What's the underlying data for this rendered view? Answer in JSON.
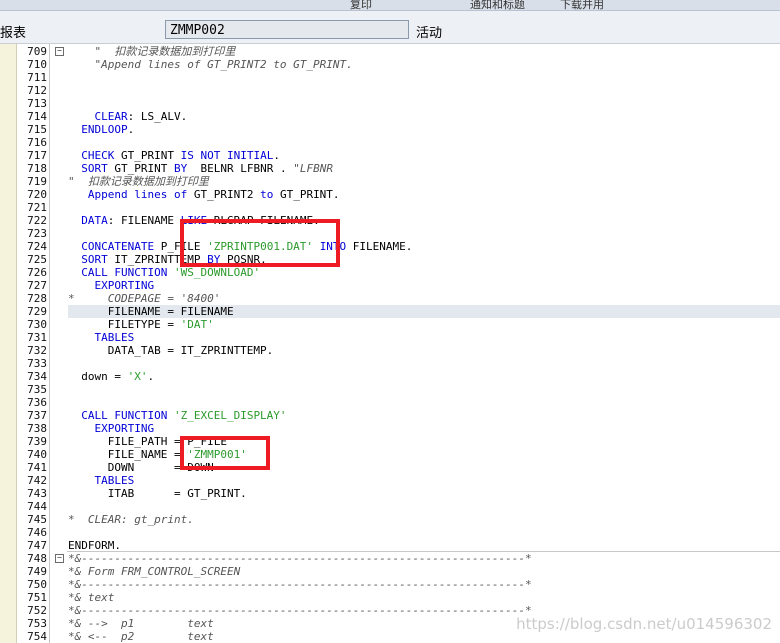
{
  "top_strip": {
    "text_fragments": [
      "复印",
      "通知和标题",
      "下载并用"
    ]
  },
  "header": {
    "label": "报表",
    "program": "ZMMP002",
    "status": "活动"
  },
  "watermark": "https://blog.csdn.net/u014596302",
  "lines": [
    {
      "n": "709",
      "fold": "minus",
      "segs": [
        [
          "c",
          "    \"  扣款记录数据加到打印里"
        ]
      ]
    },
    {
      "n": "710",
      "segs": [
        [
          "c",
          "    \"Append lines of GT_PRINT2 to GT_PRINT."
        ]
      ]
    },
    {
      "n": "711",
      "segs": []
    },
    {
      "n": "712",
      "segs": []
    },
    {
      "n": "713",
      "segs": []
    },
    {
      "n": "714",
      "segs": [
        [
          "t",
          "    "
        ],
        [
          "k",
          "CLEAR"
        ],
        [
          "t",
          ": LS_ALV."
        ]
      ]
    },
    {
      "n": "715",
      "segs": [
        [
          "t",
          "  "
        ],
        [
          "k",
          "ENDLOOP"
        ],
        [
          "t",
          "."
        ]
      ]
    },
    {
      "n": "716",
      "segs": []
    },
    {
      "n": "717",
      "segs": [
        [
          "t",
          "  "
        ],
        [
          "k",
          "CHECK"
        ],
        [
          "t",
          " GT_PRINT "
        ],
        [
          "k",
          "IS NOT INITIAL"
        ],
        [
          "t",
          "."
        ]
      ]
    },
    {
      "n": "718",
      "segs": [
        [
          "t",
          "  "
        ],
        [
          "k",
          "SORT"
        ],
        [
          "t",
          " GT_PRINT "
        ],
        [
          "k",
          "BY"
        ],
        [
          "t",
          "  BELNR LFBNR . "
        ],
        [
          "c",
          "\"LFBNR"
        ]
      ]
    },
    {
      "n": "719",
      "segs": [
        [
          "c",
          "\"  扣款记录数据加到打印里"
        ]
      ]
    },
    {
      "n": "720",
      "segs": [
        [
          "t",
          "   "
        ],
        [
          "k",
          "Append lines of"
        ],
        [
          "t",
          " GT_PRINT2 "
        ],
        [
          "k",
          "to"
        ],
        [
          "t",
          " GT_PRINT."
        ]
      ]
    },
    {
      "n": "721",
      "segs": []
    },
    {
      "n": "722",
      "segs": [
        [
          "t",
          "  "
        ],
        [
          "k",
          "DATA"
        ],
        [
          "t",
          ": FILENAME "
        ],
        [
          "k",
          "LIKE"
        ],
        [
          "t",
          " RLGRAP-FILENAME."
        ]
      ]
    },
    {
      "n": "723",
      "segs": []
    },
    {
      "n": "724",
      "segs": [
        [
          "t",
          "  "
        ],
        [
          "k",
          "CONCATENATE"
        ],
        [
          "t",
          " P_FILE "
        ],
        [
          "s",
          "'ZPRINTP001.DAT'"
        ],
        [
          "t",
          " "
        ],
        [
          "k",
          "INTO"
        ],
        [
          "t",
          " FILENAME."
        ]
      ]
    },
    {
      "n": "725",
      "segs": [
        [
          "t",
          "  "
        ],
        [
          "k",
          "SORT"
        ],
        [
          "t",
          " IT_ZPRINTTEMP "
        ],
        [
          "k",
          "BY"
        ],
        [
          "t",
          " POSNR."
        ]
      ]
    },
    {
      "n": "726",
      "segs": [
        [
          "t",
          "  "
        ],
        [
          "k",
          "CALL FUNCTION"
        ],
        [
          "t",
          " "
        ],
        [
          "s",
          "'WS_DOWNLOAD'"
        ]
      ]
    },
    {
      "n": "727",
      "segs": [
        [
          "t",
          "    "
        ],
        [
          "k",
          "EXPORTING"
        ]
      ]
    },
    {
      "n": "728",
      "segs": [
        [
          "c",
          "*     CODEPAGE = '8400'"
        ]
      ]
    },
    {
      "n": "729",
      "hl": true,
      "segs": [
        [
          "t",
          "      FILENAME = FILENAME"
        ]
      ]
    },
    {
      "n": "730",
      "segs": [
        [
          "t",
          "      FILETYPE = "
        ],
        [
          "s",
          "'DAT'"
        ]
      ]
    },
    {
      "n": "731",
      "segs": [
        [
          "t",
          "    "
        ],
        [
          "k",
          "TABLES"
        ]
      ]
    },
    {
      "n": "732",
      "segs": [
        [
          "t",
          "      DATA_TAB = IT_ZPRINTTEMP."
        ]
      ]
    },
    {
      "n": "733",
      "segs": []
    },
    {
      "n": "734",
      "segs": [
        [
          "t",
          "  down = "
        ],
        [
          "s",
          "'X'"
        ],
        [
          "t",
          "."
        ]
      ]
    },
    {
      "n": "735",
      "segs": []
    },
    {
      "n": "736",
      "segs": []
    },
    {
      "n": "737",
      "segs": [
        [
          "t",
          "  "
        ],
        [
          "k",
          "CALL FUNCTION"
        ],
        [
          "t",
          " "
        ],
        [
          "s",
          "'Z_EXCEL_DISPLAY'"
        ]
      ]
    },
    {
      "n": "738",
      "segs": [
        [
          "t",
          "    "
        ],
        [
          "k",
          "EXPORTING"
        ]
      ]
    },
    {
      "n": "739",
      "segs": [
        [
          "t",
          "      FILE_PATH = P_FILE"
        ]
      ]
    },
    {
      "n": "740",
      "segs": [
        [
          "t",
          "      FILE_NAME = "
        ],
        [
          "s",
          "'ZMMP001'"
        ]
      ]
    },
    {
      "n": "741",
      "segs": [
        [
          "t",
          "      DOWN      = DOWN"
        ]
      ]
    },
    {
      "n": "742",
      "segs": [
        [
          "t",
          "    "
        ],
        [
          "k",
          "TABLES"
        ]
      ]
    },
    {
      "n": "743",
      "segs": [
        [
          "t",
          "      ITAB      = GT_PRINT."
        ]
      ]
    },
    {
      "n": "744",
      "segs": []
    },
    {
      "n": "745",
      "segs": [
        [
          "c",
          "*  CLEAR: gt_print."
        ]
      ]
    },
    {
      "n": "746",
      "segs": []
    },
    {
      "n": "747",
      "segs": [
        [
          "t",
          "ENDFORM."
        ]
      ]
    },
    {
      "n": "748",
      "fold": "minus",
      "segs": [
        [
          "c",
          "*&-------------------------------------------------------------------*"
        ]
      ]
    },
    {
      "n": "749",
      "segs": [
        [
          "c",
          "*& Form FRM_CONTROL_SCREEN"
        ]
      ]
    },
    {
      "n": "750",
      "segs": [
        [
          "c",
          "*&-------------------------------------------------------------------*"
        ]
      ]
    },
    {
      "n": "751",
      "segs": [
        [
          "c",
          "*& text"
        ]
      ]
    },
    {
      "n": "752",
      "segs": [
        [
          "c",
          "*&-------------------------------------------------------------------*"
        ]
      ]
    },
    {
      "n": "753",
      "segs": [
        [
          "c",
          "*& -->  p1        text"
        ]
      ]
    },
    {
      "n": "754",
      "segs": [
        [
          "c",
          "*& <--  p2        text"
        ]
      ]
    }
  ]
}
